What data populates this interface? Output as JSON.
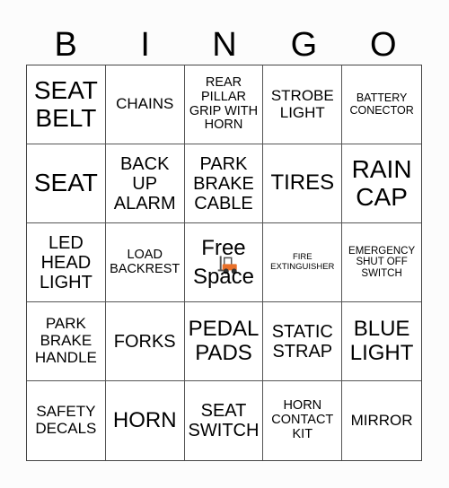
{
  "header": {
    "letters": [
      "B",
      "I",
      "N",
      "G",
      "O"
    ]
  },
  "cells": [
    {
      "text": "SEAT\nBELT",
      "size": "xl"
    },
    {
      "text": "CHAINS",
      "size": "sm"
    },
    {
      "text": "REAR\nPILLAR\nGRIP WITH\nHORN",
      "size": "14"
    },
    {
      "text": "STROBE\nLIGHT",
      "size": "sm"
    },
    {
      "text": "BATTERY\nCONECTOR",
      "size": "12"
    },
    {
      "text": "SEAT",
      "size": "xl"
    },
    {
      "text": "BACK\nUP\nALARM",
      "size": "md"
    },
    {
      "text": "PARK\nBRAKE\nCABLE",
      "size": "md"
    },
    {
      "text": "TIRES",
      "size": "lg"
    },
    {
      "text": "RAIN\nCAP",
      "size": "xl"
    },
    {
      "text": "LED\nHEAD\nLIGHT",
      "size": "md"
    },
    {
      "text": "LOAD\nBACKREST",
      "size": "14"
    },
    {
      "text": "Free\nSpace",
      "size": "free",
      "free": true,
      "icon": "forklift-icon"
    },
    {
      "text": "FIRE\nEXTINGUISHER",
      "size": "9"
    },
    {
      "text": "EMERGENCY\nSHUT OFF\nSWITCH",
      "size": "11"
    },
    {
      "text": "PARK\nBRAKE\nHANDLE",
      "size": "sm"
    },
    {
      "text": "FORKS",
      "size": "md"
    },
    {
      "text": "PEDAL\nPADS",
      "size": "lg"
    },
    {
      "text": "STATIC\nSTRAP",
      "size": "md"
    },
    {
      "text": "BLUE\nLIGHT",
      "size": "lg"
    },
    {
      "text": "SAFETY\nDECALS",
      "size": "sm"
    },
    {
      "text": "HORN",
      "size": "lg"
    },
    {
      "text": "SEAT\nSWITCH",
      "size": "md"
    },
    {
      "text": "HORN\nCONTACT\nKIT",
      "size": "14"
    },
    {
      "text": "MIRROR",
      "size": "sm"
    }
  ],
  "colors": {
    "forklift_body": "#e8702a",
    "forklift_mast": "#555555"
  }
}
